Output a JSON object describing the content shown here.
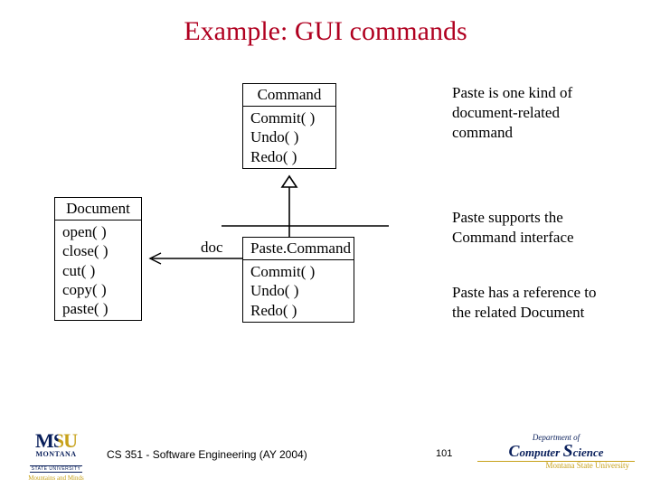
{
  "title": "Example: GUI commands",
  "uml": {
    "command": {
      "name": "Command",
      "ops": [
        "Commit( )",
        "Undo( )",
        "Redo( )"
      ]
    },
    "pasteCommand": {
      "name": "Paste.Command",
      "ops": [
        "Commit( )",
        "Undo( )",
        "Redo( )"
      ]
    },
    "document": {
      "name": "Document",
      "ops": [
        "open( )",
        "close( )",
        "cut( )",
        "copy( )",
        "paste( )"
      ]
    },
    "assocLabel": "doc"
  },
  "notes": {
    "n1": "Paste is one kind of document-related command",
    "n2": "Paste supports the Command interface",
    "n3": "Paste has a reference to the related Document"
  },
  "footer": {
    "course": "CS 351 - Software Engineering (AY 2004)",
    "page": "101"
  },
  "logos": {
    "msu": {
      "line1": "MONTANA",
      "line2": "STATE UNIVERSITY",
      "tagline": "Mountains and Minds"
    },
    "cs": {
      "dept": "Department of",
      "main_pre": "C",
      "main_mid1": "omputer ",
      "main_cap": "S",
      "main_mid2": "cience",
      "sub": "Montana State University"
    }
  }
}
